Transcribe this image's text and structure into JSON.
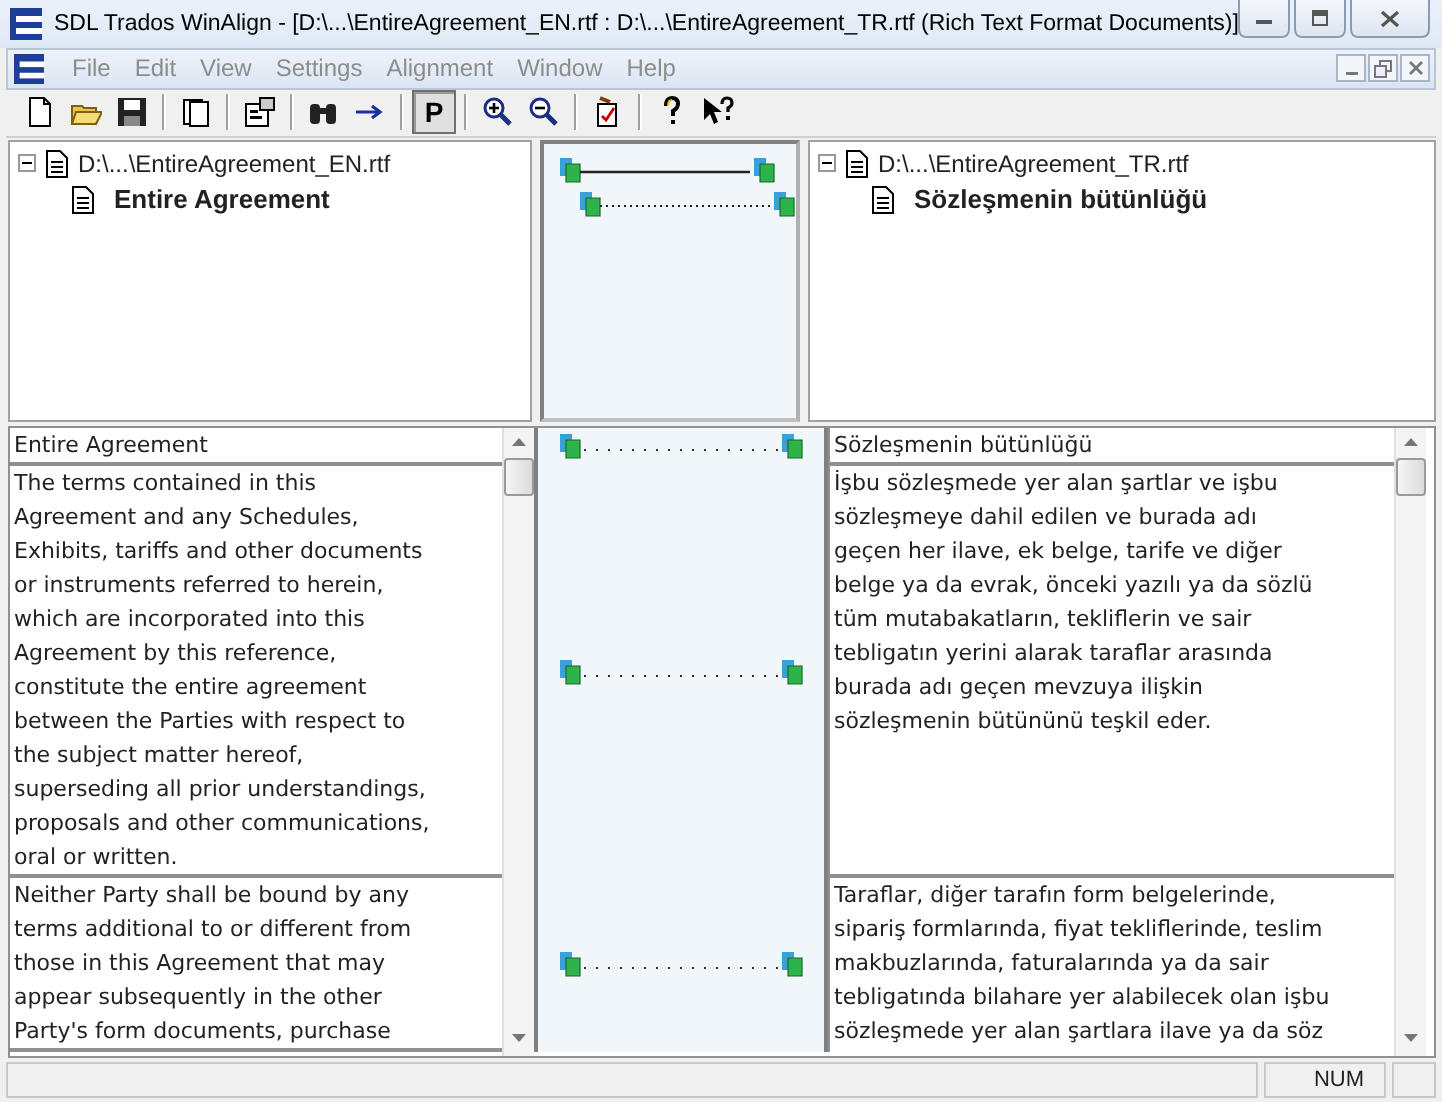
{
  "window": {
    "title": "SDL Trados WinAlign - [D:\\...\\EntireAgreement_EN.rtf : D:\\...\\EntireAgreement_TR.rtf (Rich Text Format Documents)]"
  },
  "menu": [
    "File",
    "Edit",
    "View",
    "Settings",
    "Alignment",
    "Window",
    "Help"
  ],
  "toolbar": [
    {
      "kind": "new"
    },
    {
      "kind": "open"
    },
    {
      "kind": "save"
    },
    {
      "kind": "separator"
    },
    {
      "kind": "documents"
    },
    {
      "kind": "separator"
    },
    {
      "kind": "properties"
    },
    {
      "kind": "separator"
    },
    {
      "kind": "find"
    },
    {
      "kind": "next"
    },
    {
      "kind": "separator"
    },
    {
      "kind": "toggle",
      "label": "P",
      "selected": true
    },
    {
      "kind": "separator"
    },
    {
      "kind": "zoom-in"
    },
    {
      "kind": "zoom-out"
    },
    {
      "kind": "separator"
    },
    {
      "kind": "edit"
    },
    {
      "kind": "separator"
    },
    {
      "kind": "help"
    },
    {
      "kind": "context-help"
    }
  ],
  "structure": {
    "source": {
      "file": "D:\\...\\EntireAgreement_EN.rtf",
      "expanded": true,
      "children": [
        {
          "label": "Entire Agreement"
        }
      ]
    },
    "target": {
      "file": "D:\\...\\EntireAgreement_TR.rtf",
      "expanded": true,
      "children": [
        {
          "label": "Sözleşmenin bütünlüğü"
        }
      ]
    },
    "links": [
      {
        "kind": "solid"
      },
      {
        "kind": "dotted"
      }
    ]
  },
  "segments": [
    {
      "kind": "header",
      "source": [
        "Entire Agreement"
      ],
      "target": [
        "Sözleşmenin bütünlüğü"
      ]
    },
    {
      "kind": "body",
      "source": [
        "The terms contained in this",
        "Agreement and any Schedules,",
        "Exhibits, tariffs and other documents",
        "or instruments referred to herein,",
        "which are incorporated into this",
        "Agreement by this reference,",
        "constitute the entire agreement",
        "between the Parties with respect to",
        "the subject matter hereof,",
        "superseding all prior understandings,",
        "proposals and other communications,",
        "oral or written."
      ],
      "target": [
        "İşbu sözleşmede yer alan şartlar ve işbu",
        "sözleşmeye dahil edilen ve burada adı",
        "geçen her ilave, ek belge, tarife ve diğer",
        "belge ya da evrak, önceki yazılı ya da sözlü",
        "tüm mutabakatların, tekliflerin ve sair",
        "tebligatın yerini alarak taraflar arasında",
        "burada adı geçen mevzuya ilişkin",
        "sözleşmenin bütününü teşkil eder."
      ]
    },
    {
      "kind": "body",
      "source": [
        "Neither Party shall be bound by any",
        "terms additional to or different from",
        "those in this Agreement that may",
        "appear subsequently in the other",
        "Party's form documents, purchase"
      ],
      "target": [
        "Taraflar, diğer tarafın form belgelerinde,",
        "sipariş formlarında, fiyat tekliflerinde, teslim",
        "makbuzlarında, faturalarında ya da sair",
        "tebligatında bilahare yer alabilecek olan işbu",
        "sözleşmede yer alan şartlara ilave ya da söz"
      ]
    }
  ],
  "status_bar": {
    "num": "NUM"
  }
}
